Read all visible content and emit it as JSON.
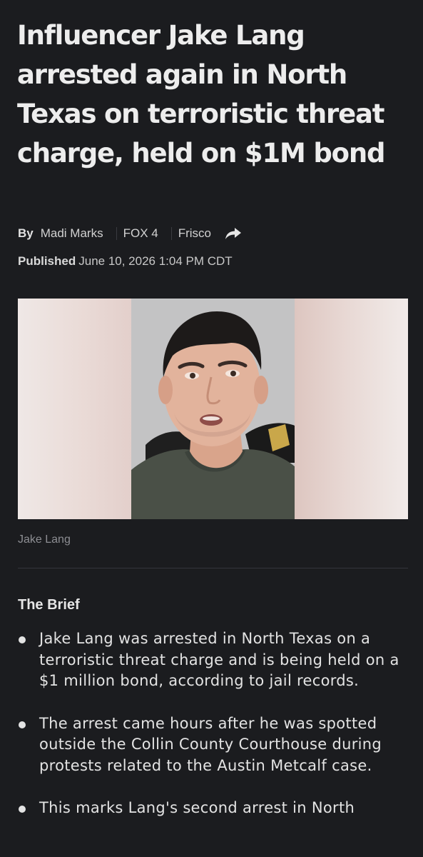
{
  "article": {
    "headline": "Influencer Jake Lang arrested again in North Texas on terroristic threat charge, held on $1M bond",
    "by_label": "By",
    "author": "Madi Marks",
    "outlet": "FOX 4",
    "location": "Frisco",
    "published_label": "Published",
    "published_date": "June 10, 2026 1:04 PM CDT",
    "photo_caption": "Jake Lang",
    "brief_heading": "The Brief",
    "brief": [
      "Jake Lang was arrested in North Texas on a terroristic threat charge and is being held on a $1 million bond, according to jail records.",
      "The arrest came hours after he was spotted outside the Collin County Courthouse during protests related to the Austin Metcalf case.",
      "This marks Lang's second arrest in North"
    ]
  },
  "icons": {
    "share": "share-arrow-icon"
  },
  "colors": {
    "background": "#1b1c1f",
    "text": "#e8e8e8",
    "muted": "#8d8e93",
    "divider": "#34363c"
  }
}
